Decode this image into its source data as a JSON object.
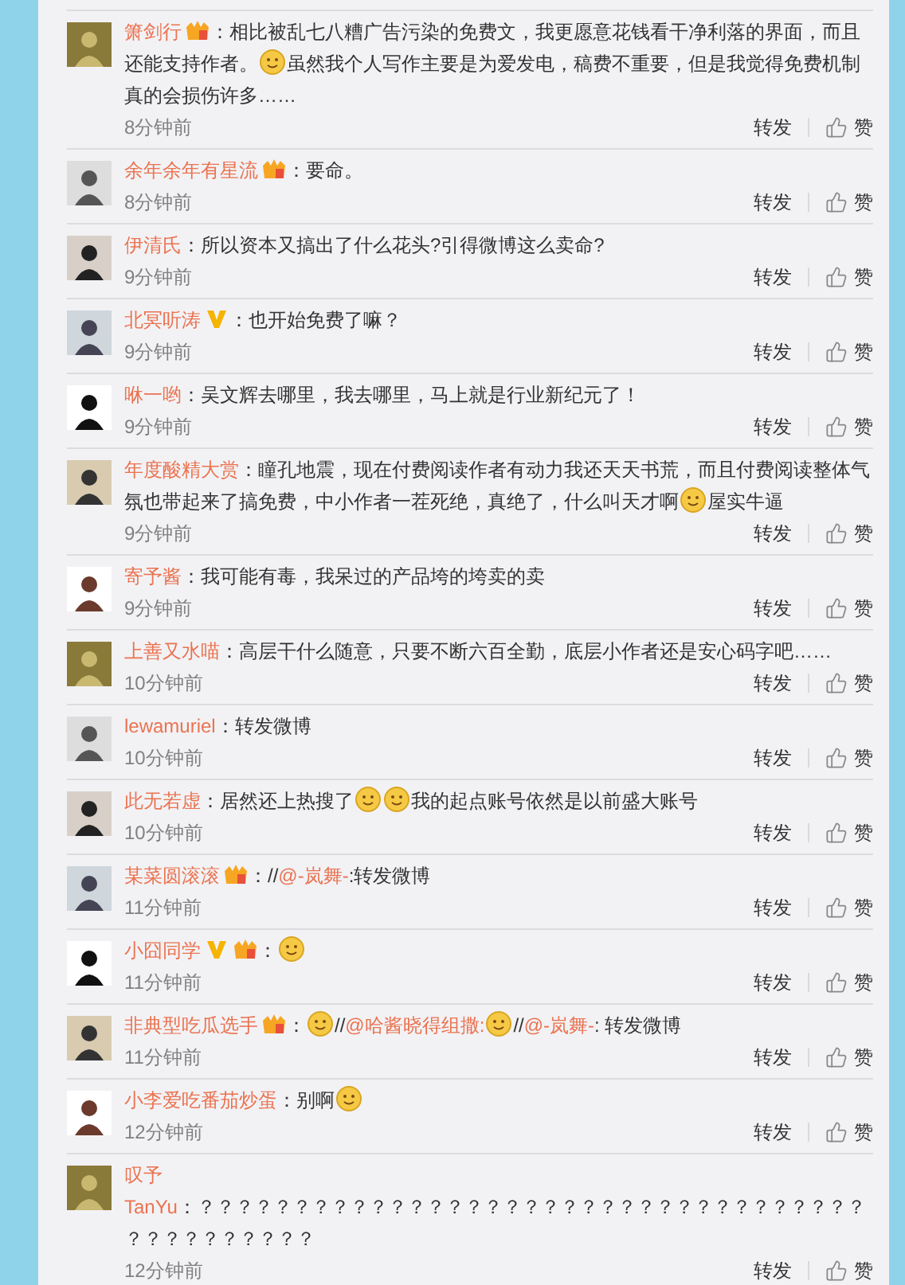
{
  "comments": [
    {
      "name": "箫剑行",
      "vip": true,
      "verified": false,
      "segments": [
        {
          "kind": "text",
          "text": "：相比被乱七八糟广告污染的免费文，我更愿意花钱看干净利落的界面，而且还能支持作者。"
        },
        {
          "kind": "emoji"
        },
        {
          "kind": "text",
          "text": "虽然我个人写作主要是为爱发电，稿费不重要，但是我觉得免费机制真的会损伤许多……"
        }
      ],
      "time": "8分钟前",
      "repost": "转发",
      "like": "赞"
    },
    {
      "name": "余年余年有星流",
      "vip": true,
      "verified": false,
      "segments": [
        {
          "kind": "text",
          "text": "：要命。"
        }
      ],
      "time": "8分钟前",
      "repost": "转发",
      "like": "赞"
    },
    {
      "name": "伊清氏",
      "vip": false,
      "verified": false,
      "segments": [
        {
          "kind": "text",
          "text": "：所以资本又搞出了什么花头?引得微博这么卖命?"
        }
      ],
      "time": "9分钟前",
      "repost": "转发",
      "like": "赞"
    },
    {
      "name": "北冥听涛",
      "vip": false,
      "verified": true,
      "segments": [
        {
          "kind": "text",
          "text": "：也开始免费了嘛？"
        }
      ],
      "time": "9分钟前",
      "repost": "转发",
      "like": "赞"
    },
    {
      "name": "咻一哟",
      "vip": false,
      "verified": false,
      "segments": [
        {
          "kind": "text",
          "text": "：吴文辉去哪里，我去哪里，马上就是行业新纪元了！"
        }
      ],
      "time": "9分钟前",
      "repost": "转发",
      "like": "赞"
    },
    {
      "name": "年度酸精大赏",
      "vip": false,
      "verified": false,
      "segments": [
        {
          "kind": "text",
          "text": "：瞳孔地震，现在付费阅读作者有动力我还天天书荒，而且付费阅读整体气氛也带起来了搞免费，中小作者一茬死绝，真绝了，什么叫天才啊"
        },
        {
          "kind": "emoji"
        },
        {
          "kind": "text",
          "text": "屋实牛逼"
        }
      ],
      "time": "9分钟前",
      "repost": "转发",
      "like": "赞"
    },
    {
      "name": "寄予酱",
      "vip": false,
      "verified": false,
      "segments": [
        {
          "kind": "text",
          "text": "：我可能有毒，我呆过的产品垮的垮卖的卖"
        }
      ],
      "time": "9分钟前",
      "repost": "转发",
      "like": "赞"
    },
    {
      "name": "上善又水喵",
      "vip": false,
      "verified": false,
      "segments": [
        {
          "kind": "text",
          "text": "：高层干什么随意，只要不断六百全勤，底层小作者还是安心码字吧……"
        }
      ],
      "time": "10分钟前",
      "repost": "转发",
      "like": "赞"
    },
    {
      "name": "lewamuriel",
      "vip": false,
      "verified": false,
      "segments": [
        {
          "kind": "text",
          "text": "：转发微博"
        }
      ],
      "time": "10分钟前",
      "repost": "转发",
      "like": "赞"
    },
    {
      "name": "此无若虚",
      "vip": false,
      "verified": false,
      "segments": [
        {
          "kind": "text",
          "text": "：居然还上热搜了"
        },
        {
          "kind": "emoji"
        },
        {
          "kind": "emoji"
        },
        {
          "kind": "text",
          "text": "我的起点账号依然是以前盛大账号"
        }
      ],
      "time": "10分钟前",
      "repost": "转发",
      "like": "赞"
    },
    {
      "name": "某菜圆滚滚",
      "vip": true,
      "verified": false,
      "segments": [
        {
          "kind": "text",
          "text": "：//"
        },
        {
          "kind": "mention",
          "text": "@-岚舞-"
        },
        {
          "kind": "text",
          "text": ":转发微博"
        }
      ],
      "time": "11分钟前",
      "repost": "转发",
      "like": "赞"
    },
    {
      "name": "小囧同学",
      "vip": true,
      "verified": true,
      "segments": [
        {
          "kind": "text",
          "text": "："
        },
        {
          "kind": "emoji"
        }
      ],
      "time": "11分钟前",
      "repost": "转发",
      "like": "赞"
    },
    {
      "name": "非典型吃瓜选手",
      "vip": true,
      "verified": false,
      "segments": [
        {
          "kind": "text",
          "text": "："
        },
        {
          "kind": "emoji"
        },
        {
          "kind": "text",
          "text": "//"
        },
        {
          "kind": "mention",
          "text": "@哈酱晓得组撒:"
        },
        {
          "kind": "emoji"
        },
        {
          "kind": "text",
          "text": "//"
        },
        {
          "kind": "mention",
          "text": "@-岚舞-"
        },
        {
          "kind": "text",
          "text": ": 转发微博"
        }
      ],
      "time": "11分钟前",
      "repost": "转发",
      "like": "赞"
    },
    {
      "name": "小李爱吃番茄炒蛋",
      "vip": false,
      "verified": false,
      "segments": [
        {
          "kind": "text",
          "text": "：别啊"
        },
        {
          "kind": "emoji"
        }
      ],
      "time": "12分钟前",
      "repost": "转发",
      "like": "赞"
    },
    {
      "name": "叹予",
      "vip": false,
      "verified": false,
      "body_on_new_line": true,
      "segments": [
        {
          "kind": "mention",
          "text": "TanYu"
        },
        {
          "kind": "text",
          "text": "：？？？？？？？？？？？？？？？？？？？？？？？？？？？？？？？？？？？？？？？？？？？？？"
        }
      ],
      "time": "12分钟前",
      "repost": "转发",
      "like": "赞"
    }
  ]
}
